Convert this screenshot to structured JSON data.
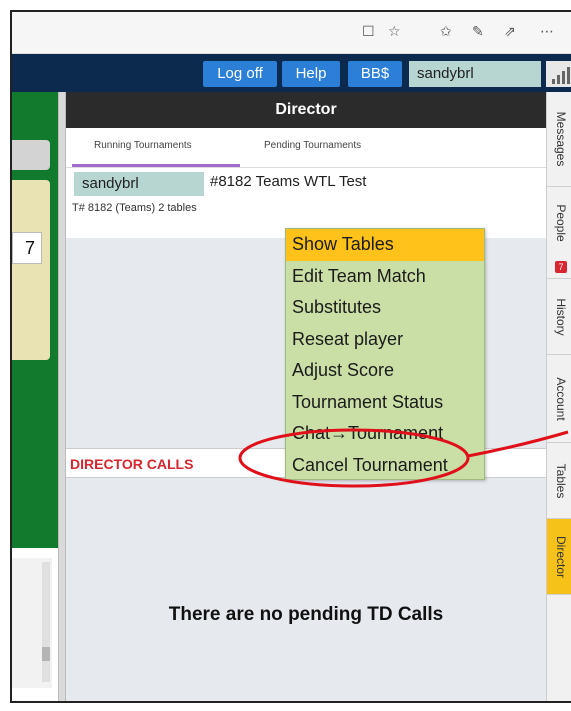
{
  "browser": {
    "icons": [
      "reading-view-icon",
      "favorite-star-icon",
      "favorites-hub-icon",
      "pen-icon",
      "share-icon",
      "more-icon"
    ],
    "glyphs": [
      "☐",
      "☆",
      "✩",
      "✎",
      "⇗",
      "⋯"
    ]
  },
  "topbar": {
    "logoff_label": "Log off",
    "help_label": "Help",
    "bbs_label": "BB$",
    "username": "sandybrl"
  },
  "director": {
    "header": "Director",
    "tabs": [
      "Running Tournaments",
      "Pending Tournaments"
    ],
    "active_tab": "Running Tournaments",
    "tournament": {
      "host": "sandybrl",
      "title": "#8182 Teams WTL Test",
      "subtitle": "T# 8182 (Teams) 2 tables"
    },
    "menu_items": [
      {
        "label": "Show Tables",
        "highlighted": true
      },
      {
        "label": "Edit Team Match",
        "highlighted": false
      },
      {
        "label": "Substitutes",
        "highlighted": false
      },
      {
        "label": "Reseat player",
        "highlighted": false
      },
      {
        "label": "Adjust Score",
        "highlighted": false
      },
      {
        "label": "Tournament Status",
        "highlighted": false
      },
      {
        "label": "Chat→Tournament",
        "highlighted": false
      },
      {
        "label": "Cancel Tournament",
        "highlighted": false
      }
    ],
    "calls_label": "DIRECTOR CALLS",
    "no_calls_text": "There are no pending TD Calls"
  },
  "left_panel": {
    "number": "7"
  },
  "side_tabs": [
    {
      "label": "Messages"
    },
    {
      "label": "People",
      "badge": "7"
    },
    {
      "label": "History"
    },
    {
      "label": "Account"
    },
    {
      "label": "Tables"
    },
    {
      "label": "Director",
      "active": true
    }
  ],
  "colors": {
    "accent_blue": "#2b7fd6",
    "nav_dark": "#0b2a4e",
    "menu_bg": "#c9dfa6",
    "menu_highlight": "#ffc21a",
    "alert_red": "#d7262f",
    "active_tab": "#f6c21a"
  }
}
